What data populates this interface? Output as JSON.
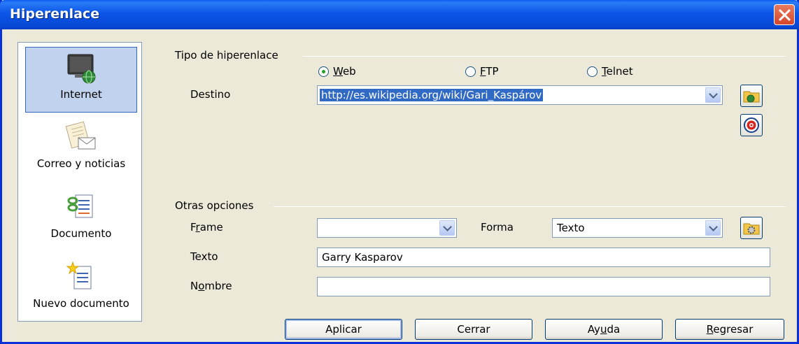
{
  "window": {
    "title": "Hiperenlace",
    "close_icon": "close-icon"
  },
  "nav": {
    "items": [
      {
        "label": "Internet",
        "icon": "internet-globe-icon",
        "selected": true
      },
      {
        "label": "Correo y noticias",
        "icon": "mail-envelope-icon",
        "selected": false
      },
      {
        "label": "Documento",
        "icon": "document-link-icon",
        "selected": false
      },
      {
        "label": "Nuevo documento",
        "icon": "new-document-icon",
        "selected": false
      }
    ]
  },
  "hyperlink_type": {
    "section_label": "Tipo de hiperenlace",
    "options": [
      {
        "label_pre": "",
        "accel": "W",
        "label_post": "eb",
        "checked": true
      },
      {
        "label_pre": "",
        "accel": "F",
        "label_post": "TP",
        "checked": false
      },
      {
        "label_pre": "",
        "accel": "T",
        "label_post": "elnet",
        "checked": false
      }
    ],
    "destino_label": "Destino",
    "destino_value": "http://es.wikipedia.org/wiki/Gari_Kaspárov"
  },
  "other_options": {
    "section_label": "Otras opciones",
    "frame_label_pre": "F",
    "frame_accel": "r",
    "frame_label_post": "ame",
    "frame_value": "",
    "forma_label": "Forma",
    "forma_value": "Texto",
    "texto_label": "Texto",
    "texto_value": "Garry Kasparov",
    "nombre_label_pre": "N",
    "nombre_accel": "o",
    "nombre_label_post": "mbre",
    "nombre_value": ""
  },
  "buttons": {
    "apply": "Aplicar",
    "close": "Cerrar",
    "help_pre": "Ay",
    "help_accel": "u",
    "help_post": "da",
    "back_pre": "",
    "back_accel": "R",
    "back_post": "egresar"
  },
  "colors": {
    "titlebar": "#0a55e8",
    "dialog_bg": "#ece9d8",
    "selection": "#316ac5"
  }
}
